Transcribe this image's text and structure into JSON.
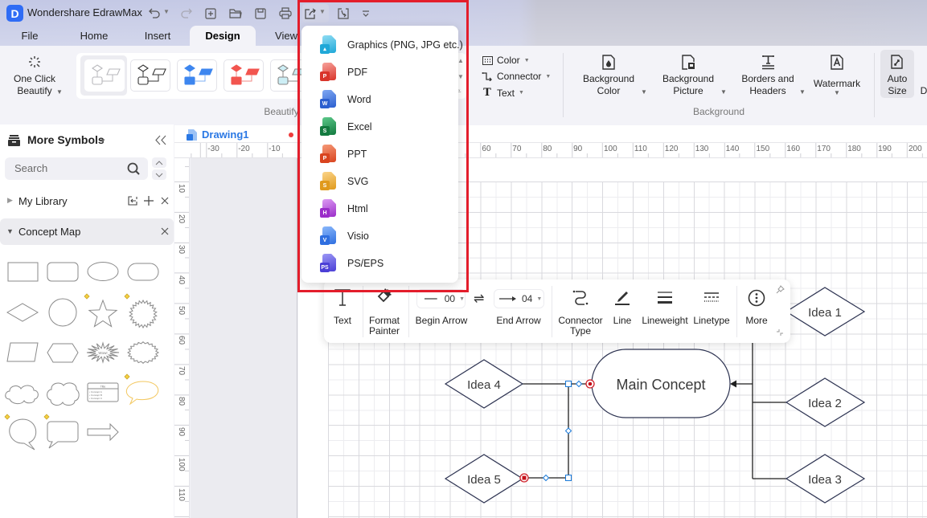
{
  "app": {
    "title": "Wondershare EdrawMax",
    "logo_letter": "D",
    "brand_color": "#2f6cf5"
  },
  "quick_access": [
    "undo-icon",
    "redo-icon",
    "new-file-icon",
    "open-folder-icon",
    "save-icon",
    "print-icon",
    "export-icon",
    "import-icon",
    "customize-icon"
  ],
  "menu_tabs": [
    {
      "label": "File"
    },
    {
      "label": "Home"
    },
    {
      "label": "Insert"
    },
    {
      "label": "Design",
      "active": true
    },
    {
      "label": "View"
    }
  ],
  "ribbon": {
    "one_click": {
      "line1": "One Click",
      "line2": "Beautify"
    },
    "beautify_group_label": "Beautify",
    "style_options": {
      "color": "Color",
      "connector": "Connector",
      "text": "Text"
    },
    "background_color": {
      "line1": "Background",
      "line2": "Color"
    },
    "background_picture": {
      "line1": "Background",
      "line2": "Picture"
    },
    "borders_headers": {
      "line1": "Borders and",
      "line2": "Headers"
    },
    "watermark": {
      "label": "Watermark"
    },
    "background_group_label": "Background",
    "auto_size": {
      "line1": "Auto",
      "line2": "Size"
    },
    "truncated_label": "D"
  },
  "export_menu": {
    "items": [
      {
        "label": "Graphics (PNG, JPG etc.)",
        "badge": "▴",
        "light": "#8fdcf3",
        "dark": "#1fa8d8"
      },
      {
        "label": "PDF",
        "badge": "P",
        "light": "#f7a29b",
        "dark": "#d9342b"
      },
      {
        "label": "Word",
        "badge": "W",
        "light": "#7fa7f2",
        "dark": "#2b5fcf"
      },
      {
        "label": "Excel",
        "badge": "S",
        "light": "#5cc98a",
        "dark": "#137a3f"
      },
      {
        "label": "PPT",
        "badge": "P",
        "light": "#f59a78",
        "dark": "#d9441f"
      },
      {
        "label": "SVG",
        "badge": "S",
        "light": "#fbd489",
        "dark": "#e09a1c"
      },
      {
        "label": "Html",
        "badge": "H",
        "light": "#dc9af3",
        "dark": "#9b2ec9"
      },
      {
        "label": "Visio",
        "badge": "V",
        "light": "#8ab8fb",
        "dark": "#2f6fe0"
      },
      {
        "label": "PS/EPS",
        "badge": "PS",
        "light": "#9c98f5",
        "dark": "#4b3fd6"
      }
    ],
    "highlight_color": "#e31d2b"
  },
  "left_panel": {
    "title": "More Symbols",
    "search": {
      "placeholder": "Search",
      "value": ""
    },
    "my_library": "My Library",
    "category": "Concept Map",
    "shape_texts": {
      "wow": "Wow!",
      "title": "Title",
      "concepts": [
        "• Concept A",
        "• Concept B",
        "• Concept C"
      ]
    }
  },
  "document": {
    "tab_label": "Drawing1",
    "unsaved": true,
    "ruler_h": [
      -30,
      -20,
      -10,
      60,
      70,
      80,
      90,
      100,
      110,
      120,
      130,
      140,
      150,
      160,
      170,
      180,
      190,
      200
    ],
    "ruler_v": [
      10,
      20,
      30,
      40,
      50,
      60,
      70,
      80,
      90,
      100,
      110
    ]
  },
  "float_toolbar": {
    "text": "Text",
    "format_painter": {
      "line1": "Format",
      "line2": "Painter"
    },
    "begin_arrow": {
      "label": "Begin Arrow",
      "value": "00"
    },
    "end_arrow": {
      "label": "End Arrow",
      "value": "04"
    },
    "connector_type": {
      "line1": "Connector",
      "line2": "Type"
    },
    "line": "Line",
    "lineweight": "Lineweight",
    "linetype": "Linetype",
    "more": "More"
  },
  "diagram": {
    "main": "Main Concept",
    "ideas": [
      "Idea 1",
      "Idea 2",
      "Idea 3",
      "Idea 4",
      "Idea 5"
    ]
  }
}
